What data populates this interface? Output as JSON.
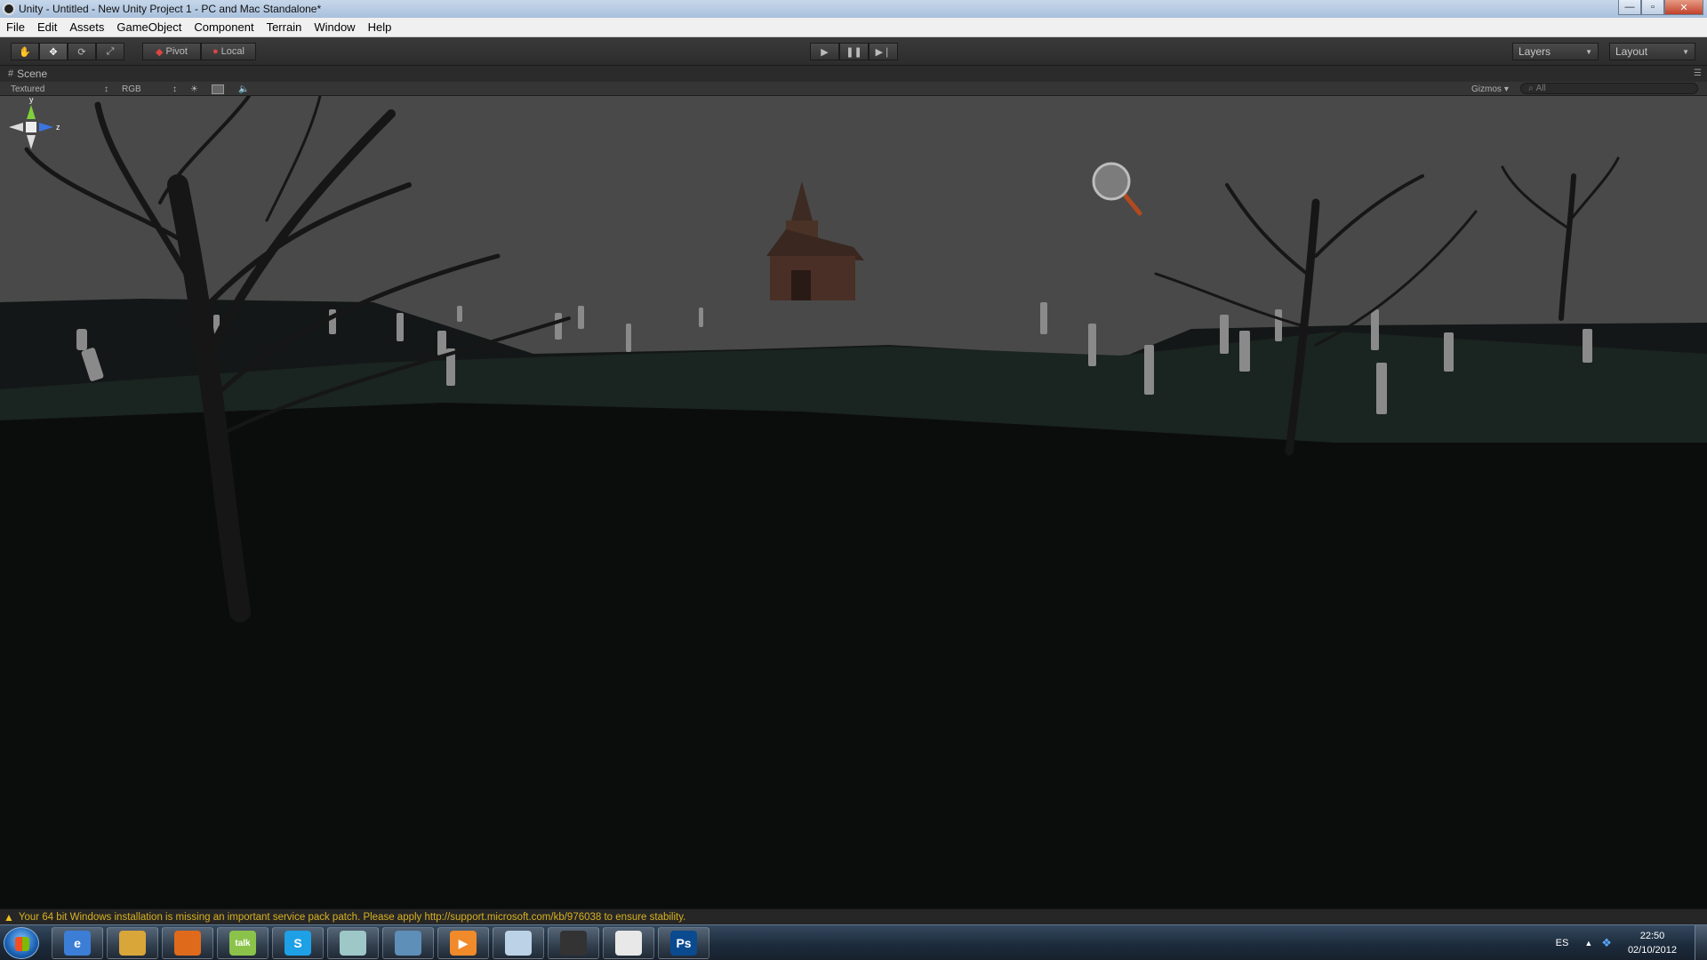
{
  "window": {
    "title": "Unity - Untitled - New Unity Project 1 - PC and Mac Standalone*",
    "minimize": "—",
    "maximize": "▫",
    "close": "✕"
  },
  "menu": [
    "File",
    "Edit",
    "Assets",
    "GameObject",
    "Component",
    "Terrain",
    "Window",
    "Help"
  ],
  "toolbar": {
    "pivot_label": "Pivot",
    "local_label": "Local",
    "layers_label": "Layers",
    "layout_label": "Layout"
  },
  "scene_panel": {
    "tab_label": "Scene",
    "render_mode": "Textured",
    "color_mode": "RGB",
    "gizmos_label": "Gizmos",
    "search_placeholder": "All"
  },
  "gizmo_axes": {
    "y": "y",
    "z": "z"
  },
  "status": {
    "message": "Your 64 bit Windows installation is missing an important service pack patch. Please apply http://support.microsoft.com/kb/976038 to ensure stability."
  },
  "taskbar": {
    "apps": [
      {
        "name": "internet-explorer",
        "color": "#3c7ed6",
        "label": "e"
      },
      {
        "name": "file-explorer",
        "color": "#d9a63a",
        "label": ""
      },
      {
        "name": "firefox",
        "color": "#e06a1b",
        "label": ""
      },
      {
        "name": "google-talk",
        "color": "#8bc34a",
        "label": "talk"
      },
      {
        "name": "skype",
        "color": "#1ea0e6",
        "label": "S"
      },
      {
        "name": "notepad",
        "color": "#9ec7c8",
        "label": ""
      },
      {
        "name": "photo-viewer",
        "color": "#5d8fb8",
        "label": ""
      },
      {
        "name": "media-player",
        "color": "#f08a2a",
        "label": "▶"
      },
      {
        "name": "calculator",
        "color": "#bcd2e6",
        "label": ""
      },
      {
        "name": "unity",
        "color": "#333333",
        "label": ""
      },
      {
        "name": "text-editor",
        "color": "#e8e8e8",
        "label": ""
      },
      {
        "name": "photoshop",
        "color": "#0a4a8f",
        "label": "Ps"
      }
    ],
    "language": "ES",
    "time": "22:50",
    "date": "02/10/2012"
  }
}
